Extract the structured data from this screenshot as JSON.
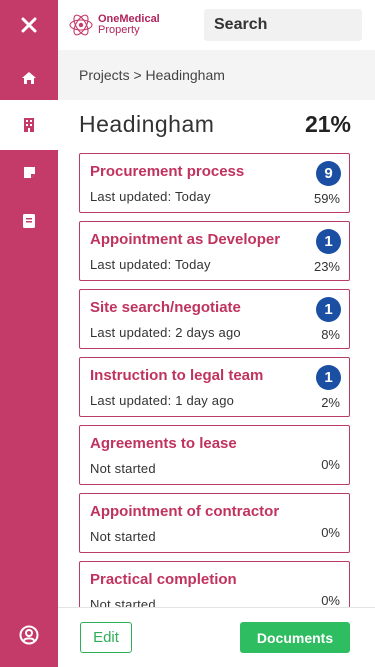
{
  "brand": {
    "line1": "OneMedical",
    "line2": "Property",
    "accent": "#c43b6a"
  },
  "search": {
    "label": "Search"
  },
  "breadcrumb": "Projects > Headingham",
  "project": {
    "title": "Headingham",
    "progress_text": "21%"
  },
  "sidebar": {
    "items": [
      {
        "icon": "close-icon"
      },
      {
        "icon": "home-icon"
      },
      {
        "icon": "building-icon",
        "active": true
      },
      {
        "icon": "note-icon"
      },
      {
        "icon": "document-icon"
      },
      {
        "icon": "user-profile-icon"
      }
    ]
  },
  "stages": [
    {
      "title": "Procurement process",
      "subtitle": "Last updated: Today",
      "badge": "9",
      "percent": "59%"
    },
    {
      "title": "Appointment as Developer",
      "subtitle": "Last updated: Today",
      "badge": "1",
      "percent": "23%"
    },
    {
      "title": "Site search/negotiate",
      "subtitle": "Last updated: 2 days ago",
      "badge": "1",
      "percent": "8%"
    },
    {
      "title": "Instruction to legal team",
      "subtitle": "Last updated: 1 day ago",
      "badge": "1",
      "percent": "2%"
    },
    {
      "title": "Agreements to lease",
      "subtitle": "Not started",
      "percent": "0%"
    },
    {
      "title": "Appointment of contractor",
      "subtitle": "Not started",
      "percent": "0%"
    },
    {
      "title": "Practical completion",
      "subtitle": "Not started",
      "percent": "0%"
    }
  ],
  "footer": {
    "edit_label": "Edit",
    "documents_label": "Documents"
  },
  "colors": {
    "card_border": "#b73d68",
    "badge": "#1a4fa3",
    "success": "#2fbd62"
  }
}
